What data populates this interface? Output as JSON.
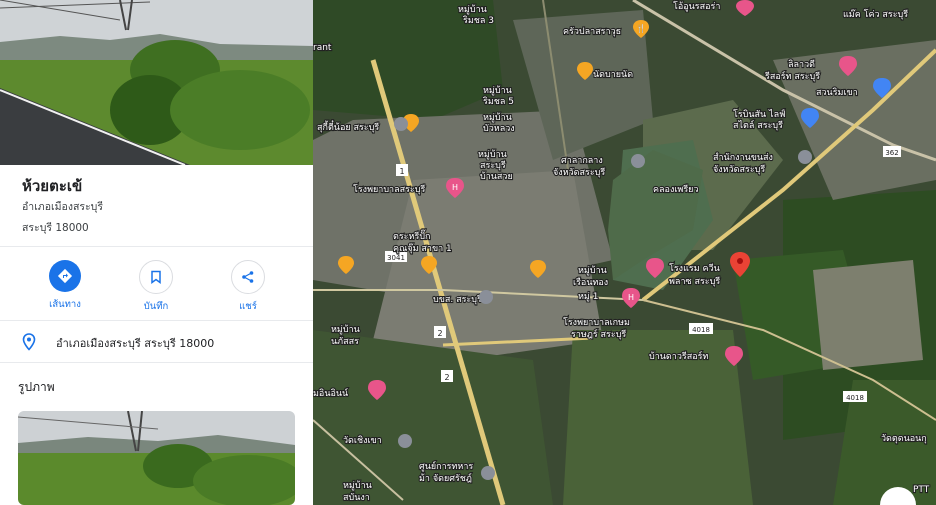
{
  "place": {
    "title": "ห้วยตะเข้",
    "district": "อำเภอเมืองสระบุรี",
    "province_zip": "สระบุรี 18000"
  },
  "actions": [
    {
      "label": "เส้นทาง",
      "icon": "directions-icon",
      "filled": true
    },
    {
      "label": "บันทึก",
      "icon": "bookmark-icon",
      "filled": false
    },
    {
      "label": "แชร์",
      "icon": "share-icon",
      "filled": false
    }
  ],
  "address": {
    "text": "อำเภอเมืองสระบุรี สระบุรี 18000",
    "icon": "location-pin-icon"
  },
  "photos": {
    "heading": "รูปภาพ"
  },
  "colors": {
    "accent": "#1a73e8",
    "pin_red": "#ea4335",
    "food_orange": "#f5a623",
    "hotel_pink": "#e8558a",
    "shop_blue": "#4285f4"
  },
  "map": {
    "places": {
      "p1": "หมู่บ้าน",
      "p1b": "ริมชล 3",
      "p2": "ครัวปลาสราวุธ",
      "p3": "โอ้อูนรสอร่า",
      "p4": "แม๊ค โค่ว สระบุรี",
      "p5": "ลิลาวดี",
      "p5b": "รีสอร์ท สระบุรี",
      "p6": "สวนริมเขา",
      "p7": "นัดบายนัด",
      "p8": "หมู่บ้าน",
      "p8b": "ริมชล 5",
      "p9": "โรบินสัน ไลฟ์",
      "p9b": "สไตล์ สระบุรี",
      "p10": "หมู่บ้าน",
      "p10b": "บัวหลวง",
      "p11": "สุกี้ตี๋น้อย สระบุรี",
      "p12": "ศาลากลาง",
      "p12b": "จังหวัดสระบุรี",
      "p13": "สำนักงานขนส่ง",
      "p13b": "จังหวัดสระบุรี",
      "p14": "หมู่บ้าน",
      "p14b": "สระบุรี",
      "p14c": "บ้านสวย",
      "p15": "โรงพยาบาลสระบุรี",
      "p16": "คลองเพรียว",
      "p17": "ตระหรีปั๊ก",
      "p17b": "คุณจุ๊ม สาขา 1",
      "p18": "หมู่บ้าน",
      "p18b": "เรือนทอง",
      "p18c": "หมู่ 1",
      "p19": "โรงแรม ควีน",
      "p19b": "พลาซ สระบุรี",
      "p20": "บขส. สระบุรี",
      "p21": "โรงพยาบาลเกษม",
      "p21b": "ราษฎร์ สระบุรี",
      "p22": "หมู่บ้าน",
      "p22b": "นภัสสร",
      "p23": "บ้านดาวรีสอร์ท",
      "p24": "มอินอินน์",
      "p25": "วัดเชิงเขา",
      "p26": "วัดตุดนอนกุ",
      "p27": "ศูนย์การทหาร",
      "p27b": "ม้า จัดยศรัชฎ์",
      "p28": "หมู่บ้าน",
      "p28b": "สบันงา",
      "p29": "PTT",
      "p30": "rant"
    },
    "routes": {
      "r1": "1",
      "r2": "2",
      "r3": "2",
      "r4": "3041",
      "r5": "4018",
      "r6": "4018",
      "r7": "362"
    }
  }
}
